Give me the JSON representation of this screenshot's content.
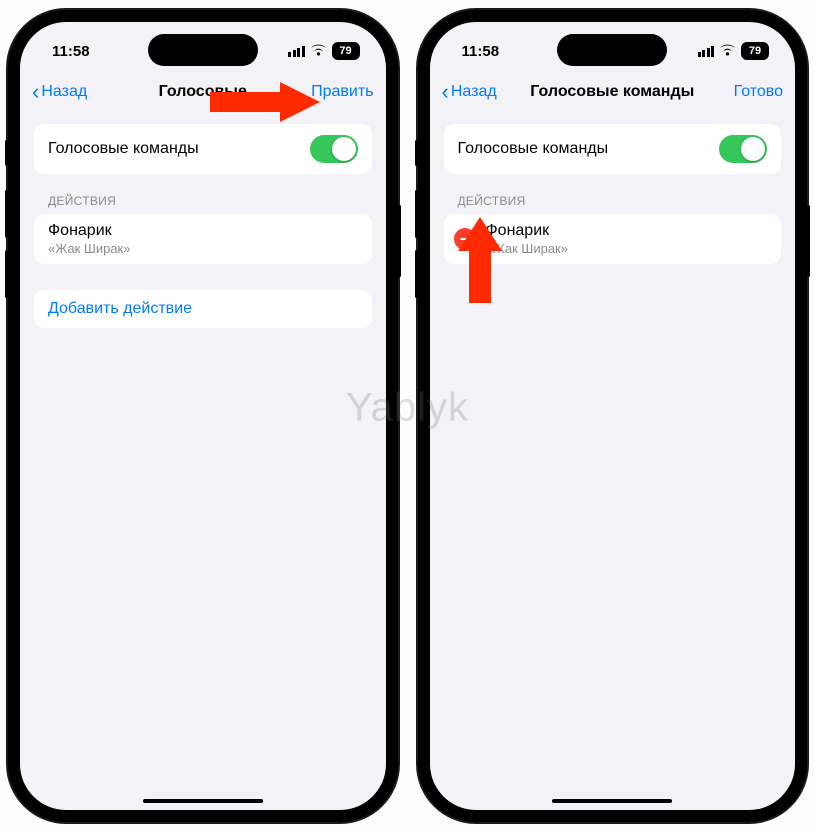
{
  "status": {
    "time": "11:58",
    "battery": "79"
  },
  "watermark": "Yablyk",
  "left": {
    "nav": {
      "back": "Назад",
      "title": "Голосовые",
      "edit": "Править"
    },
    "toggle_label": "Голосовые команды",
    "section_header": "ДЕЙСТВИЯ",
    "action": {
      "title": "Фонарик",
      "phrase": "«Жак Ширак»"
    },
    "add_label": "Добавить действие"
  },
  "right": {
    "nav": {
      "back": "Назад",
      "title": "Голосовые команды",
      "edit": "Готово"
    },
    "toggle_label": "Голосовые команды",
    "section_header": "ДЕЙСТВИЯ",
    "action": {
      "title": "Фонарик",
      "phrase": "«Жак Ширак»"
    }
  }
}
